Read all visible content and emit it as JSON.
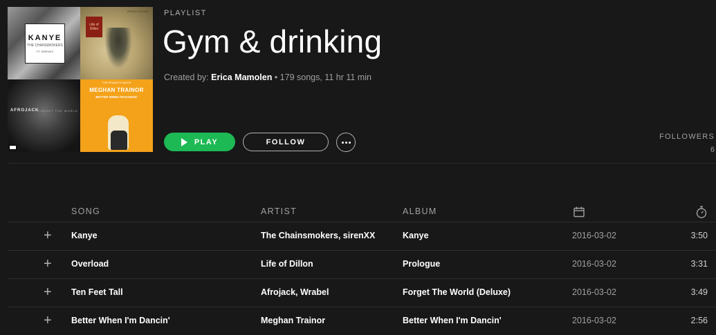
{
  "playlist": {
    "kind": "PLAYLIST",
    "title": "Gym & drinking",
    "created_by_label": "Created by:",
    "owner": "Erica Mamolen",
    "stats": " • 179 songs, 11 hr 11 min"
  },
  "cover": {
    "tile1": {
      "name": "KANYE",
      "line2": "THE CHAINSMOKERS",
      "line3": "FT. SIRENXX"
    },
    "tile2": {
      "label": "PROLOGUE",
      "emblem": "Life of Dillon"
    },
    "tile3": {
      "artist": "AFROJACK",
      "album": "FORGET THE WORLD"
    },
    "tile4": {
      "top": "THE PEANUTS MOVIE",
      "artist": "MEGHAN TRAINOR",
      "song": "BETTER WHEN I'M DANCIN'"
    }
  },
  "actions": {
    "play_label": "PLAY",
    "follow_label": "FOLLOW",
    "more_icon": "more-horizontal-icon"
  },
  "followers": {
    "label": "FOLLOWERS",
    "count": "6"
  },
  "table": {
    "columns": {
      "song": "SONG",
      "artist": "ARTIST",
      "album": "ALBUM",
      "date_icon": "calendar-icon",
      "duration_icon": "stopwatch-icon"
    },
    "rows": [
      {
        "song": "Kanye",
        "artist": "The Chainsmokers, sirenXX",
        "album": "Kanye",
        "date": "2016-03-02",
        "duration": "3:50"
      },
      {
        "song": "Overload",
        "artist": "Life of Dillon",
        "album": "Prologue",
        "date": "2016-03-02",
        "duration": "3:31"
      },
      {
        "song": "Ten Feet Tall",
        "artist": "Afrojack, Wrabel",
        "album": "Forget The World (Deluxe)",
        "date": "2016-03-02",
        "duration": "3:49"
      },
      {
        "song": "Better When I'm Dancin'",
        "artist": "Meghan Trainor",
        "album": "Better When I'm Dancin'",
        "date": "2016-03-02",
        "duration": "2:56"
      }
    ]
  },
  "colors": {
    "background": "#181818",
    "accent": "#1db954",
    "text_secondary": "#a0a0a0"
  }
}
